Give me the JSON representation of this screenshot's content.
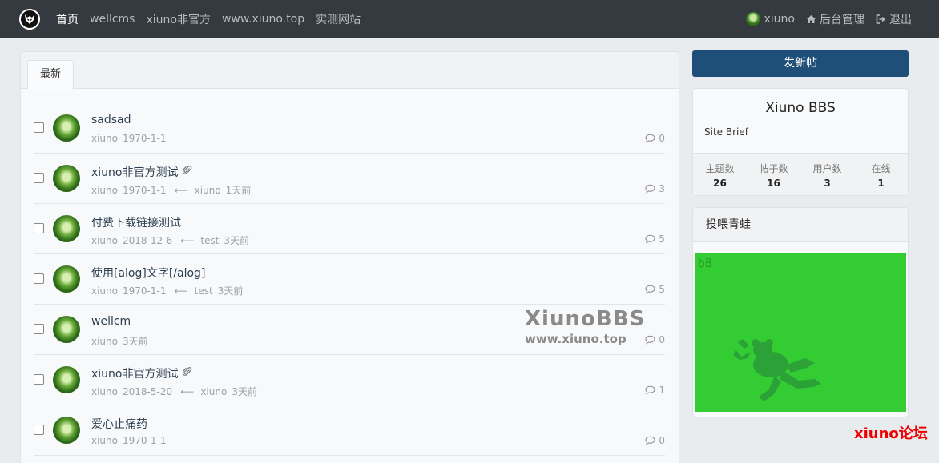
{
  "nav": {
    "links": [
      "首页",
      "wellcms",
      "xiuno非官方",
      "www.xiuno.top",
      "实测网站"
    ],
    "user": "xiuno",
    "admin": "后台管理",
    "logout": "退出"
  },
  "main": {
    "tab": "最新",
    "threads": [
      {
        "title": "sadsad",
        "author": "xiuno",
        "date": "1970-1-1",
        "last_user": "",
        "last_time": "",
        "replies": "0",
        "attach": false
      },
      {
        "title": "xiuno非官方测试",
        "author": "xiuno",
        "date": "1970-1-1",
        "last_user": "xiuno",
        "last_time": "1天前",
        "replies": "3",
        "attach": true
      },
      {
        "title": "付费下载链接测试",
        "author": "xiuno",
        "date": "2018-12-6",
        "last_user": "test",
        "last_time": "3天前",
        "replies": "5",
        "attach": false
      },
      {
        "title": "使用[alog]文字[/alog]",
        "author": "xiuno",
        "date": "1970-1-1",
        "last_user": "test",
        "last_time": "3天前",
        "replies": "5",
        "attach": false
      },
      {
        "title": "wellcm",
        "author": "xiuno",
        "date": "3天前",
        "last_user": "",
        "last_time": "",
        "replies": "0",
        "attach": false
      },
      {
        "title": "xiuno非官方测试",
        "author": "xiuno",
        "date": "2018-5-20",
        "last_user": "xiuno",
        "last_time": "3天前",
        "replies": "1",
        "attach": true
      },
      {
        "title": "爱心止痛药",
        "author": "xiuno",
        "date": "1970-1-1",
        "last_user": "",
        "last_time": "",
        "replies": "0",
        "attach": false
      }
    ],
    "watermark": {
      "big": "XiunoBBS",
      "small": "www.xiuno.top"
    }
  },
  "sidebar": {
    "new_post": "发新帖",
    "site_name": "Xiuno BBS",
    "site_brief": "Site Brief",
    "stats": [
      {
        "label": "主题数",
        "value": "26"
      },
      {
        "label": "帖子数",
        "value": "16"
      },
      {
        "label": "用户数",
        "value": "3"
      },
      {
        "label": "在线",
        "value": "1"
      }
    ],
    "feed_title": "投喂青蛙",
    "feed_tag": "ꝺB"
  },
  "brand_watermark": "xiuno论坛",
  "colors": {
    "nav_bg": "#343a40",
    "primary": "#1f4e79",
    "frog_bg": "#33cc33"
  }
}
